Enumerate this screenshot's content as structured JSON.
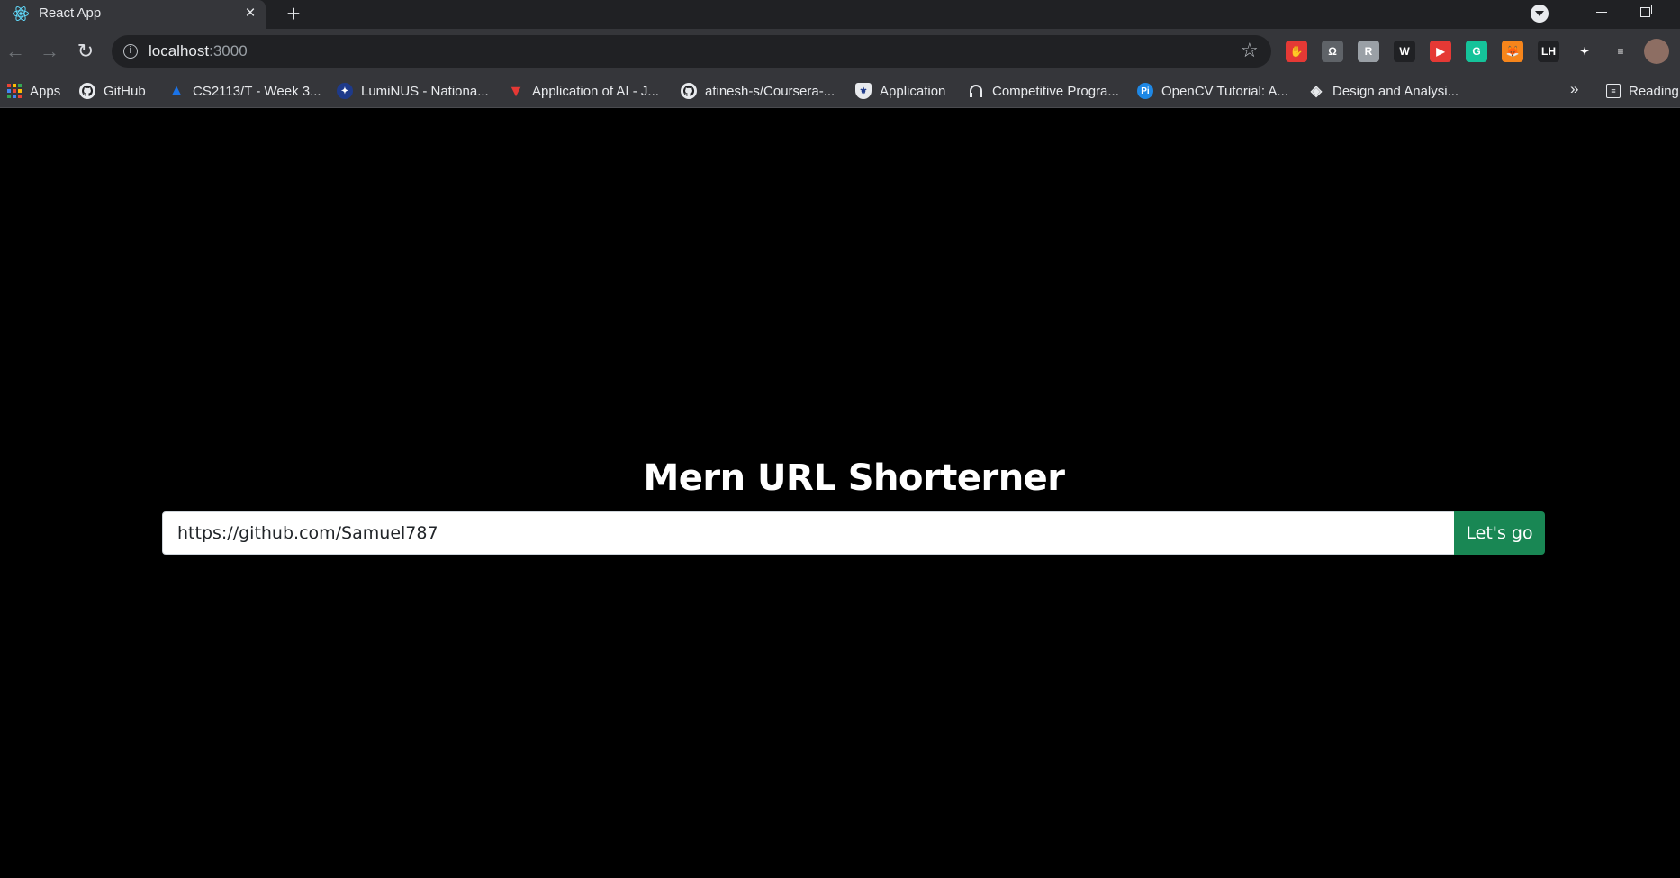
{
  "browser": {
    "tab_title": "React App",
    "tab_close": "×",
    "new_tab": "+",
    "url_host": "localhost",
    "url_port": ":3000",
    "info_glyph": "i",
    "star_glyph": "☆",
    "back_glyph": "←",
    "forward_glyph": "→",
    "reload_glyph": "↻"
  },
  "extensions": [
    {
      "name": "adblock-icon",
      "glyph": "✋",
      "color": "#e53935"
    },
    {
      "name": "omega-icon",
      "glyph": "Ω",
      "color": "#5f6368"
    },
    {
      "name": "screenshot-icon",
      "glyph": "R",
      "color": "#9aa0a6"
    },
    {
      "name": "w-icon",
      "glyph": "W",
      "color": "#202124"
    },
    {
      "name": "youtube-icon",
      "glyph": "▶",
      "color": "#e53935"
    },
    {
      "name": "grammarly-icon",
      "glyph": "G",
      "color": "#15c39a"
    },
    {
      "name": "metamask-icon",
      "glyph": "🦊",
      "color": "#f6851b"
    },
    {
      "name": "lh-icon",
      "glyph": "LH",
      "color": "#202124"
    },
    {
      "name": "puzzle-icon",
      "glyph": "✦",
      "color": "#35363a"
    },
    {
      "name": "media-icon",
      "glyph": "≡",
      "color": "#35363a"
    }
  ],
  "bookmarks": {
    "apps": "Apps",
    "items": [
      {
        "label": "GitHub",
        "icon": "github-icon"
      },
      {
        "label": "CS2113/T - Week 3...",
        "icon": "graduation-icon"
      },
      {
        "label": "LumiNUS - Nationa...",
        "icon": "luminus-icon"
      },
      {
        "label": "Application of AI - J...",
        "icon": "triangle-icon"
      },
      {
        "label": "atinesh-s/Coursera-...",
        "icon": "github-icon"
      },
      {
        "label": "Application",
        "icon": "crest-icon"
      },
      {
        "label": "Competitive Progra...",
        "icon": "headphones-icon"
      },
      {
        "label": "OpenCV Tutorial: A...",
        "icon": "pi-icon"
      },
      {
        "label": "Design and Analysi...",
        "icon": "diamond-icon"
      }
    ],
    "more": "»",
    "reading_list": "Reading"
  },
  "page": {
    "heading": "Mern URL Shorterner",
    "input_value": "https://github.com/Samuel787",
    "button_label": "Let's go"
  }
}
